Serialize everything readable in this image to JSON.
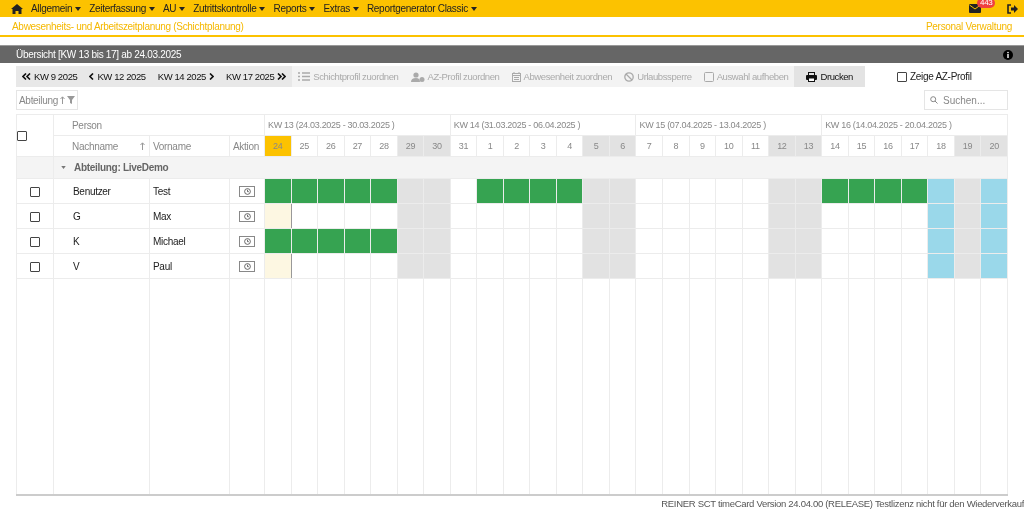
{
  "menu": [
    {
      "label": "Allgemein"
    },
    {
      "label": "Zeiterfassung"
    },
    {
      "label": "AU"
    },
    {
      "label": "Zutrittskontrolle"
    },
    {
      "label": "Reports"
    },
    {
      "label": "Extras"
    },
    {
      "label": "Reportgenerator Classic"
    }
  ],
  "mail_badge": "443",
  "page_title": "Abwesenheits- und Arbeitszeitplanung (Schichtplanung)",
  "module_name": "Personal Verwaltung",
  "panel_title": "Übersicht [KW 13 bis 17] ab 24.03.2025",
  "toolbar": [
    {
      "label": "KW 9 2025",
      "kind": "first",
      "disabled": false
    },
    {
      "label": "KW 12 2025",
      "kind": "prev",
      "disabled": false
    },
    {
      "label": "KW 14 2025",
      "kind": "next",
      "disabled": false
    },
    {
      "label": "KW 17 2025",
      "kind": "last",
      "disabled": false
    },
    {
      "label": "Schichtprofil zuordnen",
      "kind": "shift",
      "disabled": true
    },
    {
      "label": "AZ-Profil zuordnen",
      "kind": "profile",
      "disabled": true
    },
    {
      "label": "Abwesenheit zuordnen",
      "kind": "absence",
      "disabled": true
    },
    {
      "label": "Urlaubssperre",
      "kind": "block",
      "disabled": true
    },
    {
      "label": "Auswahl aufheben",
      "kind": "clear",
      "disabled": true
    },
    {
      "label": "Drucken",
      "kind": "print",
      "disabled": false
    }
  ],
  "show_az_profile": {
    "label": "Zeige AZ-Profil",
    "checked": false
  },
  "group_filter": {
    "label": "Abteilung"
  },
  "search": {
    "placeholder": "Suchen..."
  },
  "table": {
    "all_selected": false,
    "person_header": "Person",
    "columns": [
      "Nachname",
      "Vorname",
      "Aktion"
    ],
    "weeks": [
      "KW 13 (24.03.2025 - 30.03.2025 )",
      "KW 14 (31.03.2025 - 06.04.2025 )",
      "KW 15 (07.04.2025 - 13.04.2025 )",
      "KW 16 (14.04.2025 - 20.04.2025 )"
    ],
    "days": [
      {
        "label": "24",
        "today": true,
        "weekend": false,
        "holiday": false
      },
      {
        "label": "25",
        "today": false,
        "weekend": false,
        "holiday": false
      },
      {
        "label": "26",
        "today": false,
        "weekend": false,
        "holiday": false
      },
      {
        "label": "27",
        "today": false,
        "weekend": false,
        "holiday": false
      },
      {
        "label": "28",
        "today": false,
        "weekend": false,
        "holiday": false
      },
      {
        "label": "29",
        "today": false,
        "weekend": true,
        "holiday": false
      },
      {
        "label": "30",
        "today": false,
        "weekend": true,
        "holiday": false
      },
      {
        "label": "31",
        "today": false,
        "weekend": false,
        "holiday": false
      },
      {
        "label": "1",
        "today": false,
        "weekend": false,
        "holiday": false
      },
      {
        "label": "2",
        "today": false,
        "weekend": false,
        "holiday": false
      },
      {
        "label": "3",
        "today": false,
        "weekend": false,
        "holiday": false
      },
      {
        "label": "4",
        "today": false,
        "weekend": false,
        "holiday": false
      },
      {
        "label": "5",
        "today": false,
        "weekend": true,
        "holiday": false
      },
      {
        "label": "6",
        "today": false,
        "weekend": true,
        "holiday": false
      },
      {
        "label": "7",
        "today": false,
        "weekend": false,
        "holiday": false
      },
      {
        "label": "8",
        "today": false,
        "weekend": false,
        "holiday": false
      },
      {
        "label": "9",
        "today": false,
        "weekend": false,
        "holiday": false
      },
      {
        "label": "10",
        "today": false,
        "weekend": false,
        "holiday": false
      },
      {
        "label": "11",
        "today": false,
        "weekend": false,
        "holiday": false
      },
      {
        "label": "12",
        "today": false,
        "weekend": true,
        "holiday": false
      },
      {
        "label": "13",
        "today": false,
        "weekend": true,
        "holiday": false
      },
      {
        "label": "14",
        "today": false,
        "weekend": false,
        "holiday": false
      },
      {
        "label": "15",
        "today": false,
        "weekend": false,
        "holiday": false
      },
      {
        "label": "16",
        "today": false,
        "weekend": false,
        "holiday": false
      },
      {
        "label": "17",
        "today": false,
        "weekend": false,
        "holiday": false
      },
      {
        "label": "18",
        "today": false,
        "weekend": false,
        "holiday": true
      },
      {
        "label": "19",
        "today": false,
        "weekend": true,
        "holiday": false
      },
      {
        "label": "20",
        "today": false,
        "weekend": true,
        "holiday": true
      }
    ],
    "group": {
      "label": "Abteilung: LiveDemo",
      "expanded": true
    },
    "people": [
      {
        "last": "Benutzer",
        "first": "Test",
        "selected": false,
        "work": [
          true,
          true,
          true,
          true,
          true,
          false,
          false,
          false,
          true,
          true,
          true,
          true,
          false,
          false,
          false,
          false,
          false,
          false,
          false,
          false,
          false,
          true,
          true,
          true,
          true,
          false,
          false,
          false
        ]
      },
      {
        "last": "G",
        "first": "Max",
        "selected": false,
        "work": [
          false,
          false,
          false,
          false,
          false,
          false,
          false,
          false,
          false,
          false,
          false,
          false,
          false,
          false,
          false,
          false,
          false,
          false,
          false,
          false,
          false,
          false,
          false,
          false,
          false,
          false,
          false,
          false
        ]
      },
      {
        "last": "K",
        "first": "Michael",
        "selected": false,
        "work": [
          true,
          true,
          true,
          true,
          true,
          false,
          false,
          false,
          false,
          false,
          false,
          false,
          false,
          false,
          false,
          false,
          false,
          false,
          false,
          false,
          false,
          false,
          false,
          false,
          false,
          false,
          false,
          false
        ]
      },
      {
        "last": "V",
        "first": "Paul",
        "selected": false,
        "work": [
          false,
          false,
          false,
          false,
          false,
          false,
          false,
          false,
          false,
          false,
          false,
          false,
          false,
          false,
          false,
          false,
          false,
          false,
          false,
          false,
          false,
          false,
          false,
          false,
          false,
          false,
          false,
          false
        ]
      }
    ]
  },
  "footer": "REINER SCT timeCard Version 24.04.00 (RELEASE) Testlizenz nicht für den Wiederverkauf"
}
